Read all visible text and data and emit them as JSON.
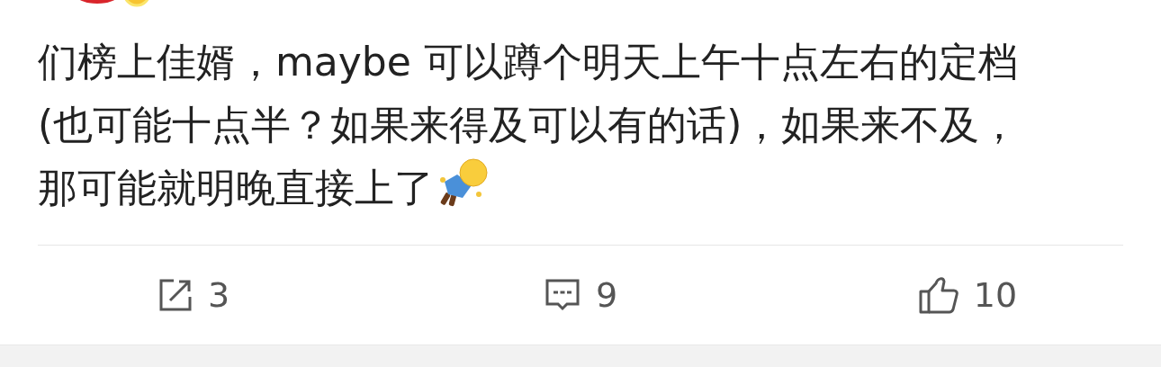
{
  "post": {
    "text": "们榜上佳婿，maybe 可以蹲个明天上午十点左右的定档(也可能十点半？如果来得及可以有的话)，如果来不及，那可能就明晚直接上了"
  },
  "actions": [
    {
      "kind": "repost",
      "count": "3"
    },
    {
      "kind": "comment",
      "count": "9"
    },
    {
      "kind": "like",
      "count": "10"
    }
  ]
}
